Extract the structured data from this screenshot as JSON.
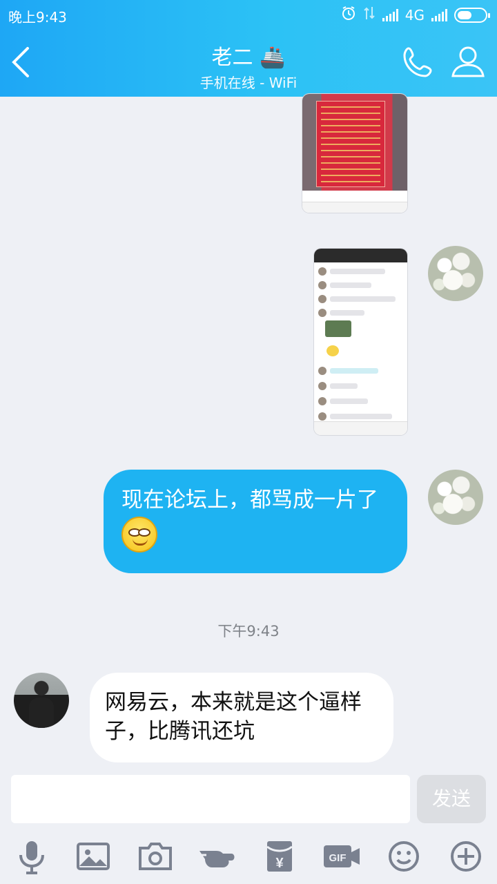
{
  "status_bar": {
    "time": "晚上9:43",
    "network": "4G"
  },
  "header": {
    "title": "老二",
    "title_emoji": "🚢",
    "subtitle": "手机在线 - WiFi"
  },
  "icons": {
    "back": "back-arrow-icon",
    "phone": "phone-icon",
    "profile": "person-icon",
    "alarm": "alarm-icon",
    "data_transfer": "data-arrows-icon",
    "signal": "signal-icon",
    "battery": "battery-icon",
    "mic": "mic-icon",
    "image": "image-icon",
    "camera": "camera-icon",
    "poke": "poke-hand-icon",
    "red_packet": "red-packet-icon",
    "gif": "gif-icon",
    "emoji": "emoji-icon",
    "plus": "plus-icon"
  },
  "messages": [
    {
      "type": "image",
      "from": "me",
      "content": "screenshot-red-notice"
    },
    {
      "type": "image",
      "from": "me",
      "content": "screenshot-chat"
    },
    {
      "type": "text",
      "from": "me",
      "text": "现在论坛上，都骂成一片了",
      "emoji": "smiley-eyes-emoji"
    },
    {
      "type": "time",
      "text": "下午9:43"
    },
    {
      "type": "text",
      "from": "other",
      "text": "网易云，本来就是这个逼样子，比腾讯还坑"
    }
  ],
  "composer": {
    "input_value": "",
    "send_label": "发送"
  },
  "toolbar": {
    "gif_label": "GIF",
    "red_packet_label": "¥"
  },
  "colors": {
    "header_start": "#1ea7f5",
    "header_end": "#3ac4f6",
    "bubble_me": "#1eb3f2",
    "bubble_other": "#ffffff",
    "background": "#eef0f5",
    "send_disabled": "#dcdee2",
    "tool_icon": "#7a8190"
  }
}
